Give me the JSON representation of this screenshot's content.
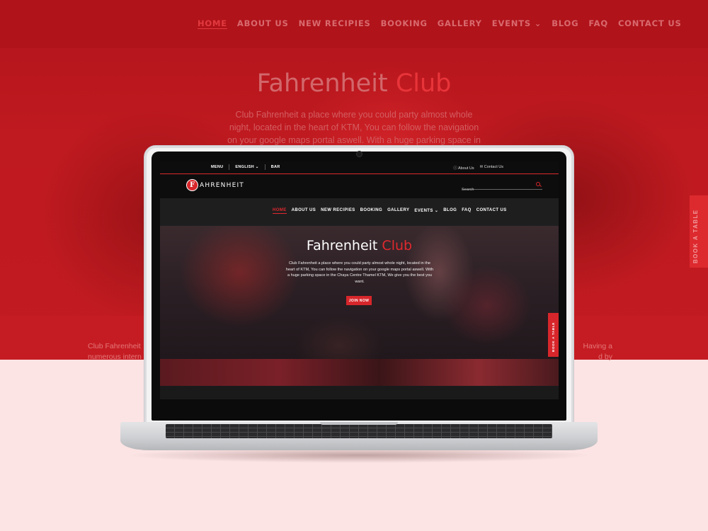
{
  "background_site": {
    "menu": [
      "HOME",
      "ABOUT US",
      "NEW RECIPIES",
      "BOOKING",
      "GALLERY",
      "EVENTS ⌄",
      "BLOG",
      "FAQ",
      "CONTACT US"
    ],
    "title_part1": "Fahrenheit",
    "title_part2": "Club",
    "description": "Club Fahrenheit a place where you could party almost whole night, located in the heart of KTM, You can follow the navigation on your google maps portal aswell. With a huge parking space in the Chaya",
    "book_tab": "BOOK A TABLE",
    "text_left": "Club Fahrenheit\nnumerous intern",
    "text_right": "Having a\nd by"
  },
  "topbar": {
    "menu": "MENU",
    "language": "ENGLISH ⌄",
    "bar": "BAR",
    "about": "About Us",
    "contact": "Contact Us"
  },
  "header": {
    "logo_letter": "F",
    "logo_text": "AHRENHEIT",
    "search_placeholder": "Search"
  },
  "nav": {
    "items": [
      "HOME",
      "ABOUT US",
      "NEW RECIPIES",
      "BOOKING",
      "GALLERY",
      "EVENTS ⌄",
      "BLOG",
      "FAQ",
      "CONTACT US"
    ]
  },
  "hero": {
    "title_part1": "Fahrenheit",
    "title_part2": "Club",
    "description": "Club Fahrenheit a place where you could party almost whole night, located in the heart of KTM, You can follow the navigation on your google maps portal aswell. With a huge parking space in the Chaya Centre Thamel KTM, We give you the best you want.",
    "button": "JOIN NOW",
    "book_tab": "BOOK A TABLE"
  },
  "colors": {
    "accent_red": "#d7262b",
    "page_background": "#fce4e4"
  }
}
